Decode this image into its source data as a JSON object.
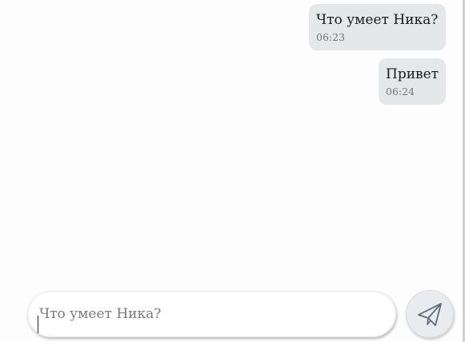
{
  "chat": {
    "messages": [
      {
        "text": "Что умеет Ника?",
        "time": "06:23"
      },
      {
        "text": "Привет",
        "time": "06:24"
      }
    ]
  },
  "composer": {
    "value": "",
    "placeholder": "Что умеет Ника?",
    "send_icon": "paper-plane-icon"
  },
  "colors": {
    "bubble": "#e4e8e8",
    "background": "#fdfdfd",
    "send_button": "#e9ecef",
    "icon_stroke": "#5f6b7a"
  }
}
